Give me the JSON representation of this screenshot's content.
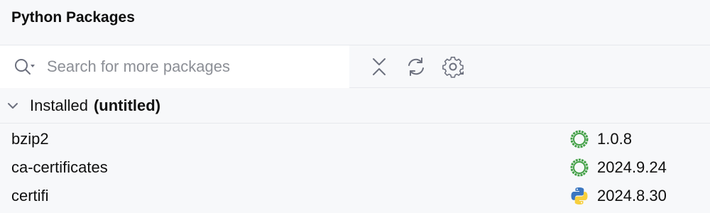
{
  "panel": {
    "title": "Python Packages"
  },
  "search": {
    "placeholder": "Search for more packages"
  },
  "toolbar": {
    "collapse_icon": "collapse-all-icon",
    "refresh_icon": "refresh-icon",
    "settings_icon": "settings-gear-icon"
  },
  "installed": {
    "label": "Installed",
    "env": "(untitled)",
    "packages": [
      {
        "name": "bzip2",
        "version": "1.0.8",
        "source_icon": "conda-icon"
      },
      {
        "name": "ca-certificates",
        "version": "2024.9.24",
        "source_icon": "conda-icon"
      },
      {
        "name": "certifi",
        "version": "2024.8.30",
        "source_icon": "python-icon"
      }
    ]
  },
  "colors": {
    "background": "#f7f8fa",
    "search_background": "#ffffff",
    "conda_green": "#43a047",
    "python_blue": "#3b76c0",
    "python_yellow": "#f7cf3d"
  }
}
